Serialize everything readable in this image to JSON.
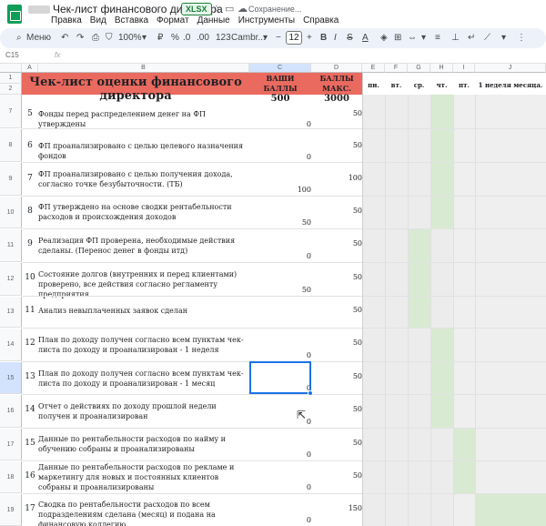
{
  "window": {
    "doc_title": "Чек-лист финансового директора",
    "format_badge": "XLSX",
    "save_status": "Сохранение..."
  },
  "menu": [
    "Правка",
    "Вид",
    "Вставка",
    "Формат",
    "Данные",
    "Инструменты",
    "Справка"
  ],
  "toolbar": {
    "menu_label": "Меню",
    "zoom": "100%",
    "currency": "₽",
    "percent": "%",
    "decimals_less": ".0",
    "decimals_more": ".00",
    "number_format": "123",
    "font": "Cambr...",
    "font_size": "12",
    "bold": "B",
    "italic": "I",
    "strike": "S",
    "text_color": "A"
  },
  "formula_bar": {
    "cell_ref": "C15",
    "fx": "fx"
  },
  "columns": [
    "A",
    "B",
    "C",
    "D",
    "E",
    "F",
    "G",
    "H",
    "I",
    "J"
  ],
  "sheet": {
    "title": "Чек-лист оценки финансового директора",
    "col_c_header": "ВАШИ БАЛЛЫ",
    "col_c_total": "500",
    "col_d_header": "БАЛЛЫ МАКС.",
    "col_d_total": "3000",
    "days": [
      "пн.",
      "вт.",
      "ср.",
      "чт.",
      "пт.",
      "1 неделя месяца."
    ],
    "header_rows": [
      "1",
      "2"
    ],
    "rows": [
      {
        "row": "7",
        "num": "5",
        "text": "Фонды перед распределением денег на ФП утверждены",
        "score": "0",
        "max": "50"
      },
      {
        "row": "8",
        "num": "6",
        "text": "ФП проанализировано с целью целевого назначения фондов",
        "score": "0",
        "max": "50"
      },
      {
        "row": "9",
        "num": "7",
        "text": "ФП проанализировано с целью получения дохода, согласно точке безубыточности. (ТБ)",
        "score": "100",
        "max": "100"
      },
      {
        "row": "10",
        "num": "8",
        "text": "ФП утверждено на основе сводки рентабельности расходов и происхождения доходов",
        "score": "50",
        "max": "50"
      },
      {
        "row": "11",
        "num": "9",
        "text": "Реализация ФП проверена, необходимые действия сделаны. (Перенос денег в фонды итд)",
        "score": "0",
        "max": "50"
      },
      {
        "row": "12",
        "num": "10",
        "text": "Состояние долгов (внутренних и перед клиентами) проверено, все действия согласно регламенту предприятия",
        "score": "50",
        "max": "50"
      },
      {
        "row": "13",
        "num": "11",
        "text": "Анализ невыплаченных заявок сделан",
        "score": "",
        "max": "50"
      },
      {
        "row": "14",
        "num": "12",
        "text": "План по доходу получен согласно всем пунктам чек-листа по доходу и проанализирован - 1 неделя",
        "score": "0",
        "max": "50"
      },
      {
        "row": "15",
        "num": "13",
        "text": "План по доходу получен согласно всем пунктам чек-листа по доходу и проанализирован - 1 месяц",
        "score": "0",
        "max": "50"
      },
      {
        "row": "16",
        "num": "14",
        "text": "Отчет о действиях по доходу прошлой недели получен и проанализирован",
        "score": "0",
        "max": "50"
      },
      {
        "row": "17",
        "num": "15",
        "text": "Данные по рентабельности расходов по найму и обучению собраны и проанализированы",
        "score": "0",
        "max": "50"
      },
      {
        "row": "18",
        "num": "16",
        "text": "Данные по рентабельности расходов по рекламе и маркетингу для новых и постоянных клиентов собраны и проанализированы",
        "score": "0",
        "max": "50"
      },
      {
        "row": "19",
        "num": "17",
        "text": "Сводка по рентабельности расходов по всем подразделениям сделана (месяц) и подана на финансовую коллегию",
        "score": "0",
        "max": "150"
      }
    ]
  },
  "colors": {
    "title_band": "#ea6a60",
    "green_cell": "#d9ead3",
    "selection": "#1a73e8"
  }
}
